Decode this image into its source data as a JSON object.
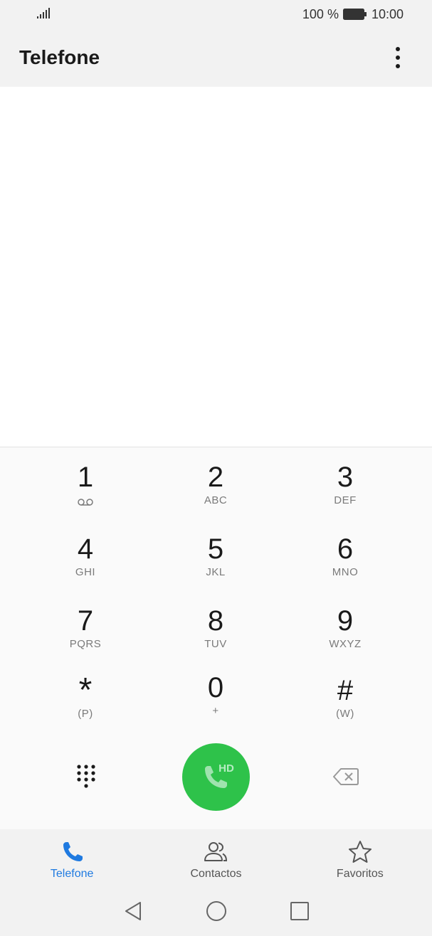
{
  "status_bar": {
    "battery": "100 %",
    "time": "10:00"
  },
  "app_bar": {
    "title": "Telefone"
  },
  "dialpad": {
    "keys": [
      {
        "digit": "1",
        "letters": ""
      },
      {
        "digit": "2",
        "letters": "ABC"
      },
      {
        "digit": "3",
        "letters": "DEF"
      },
      {
        "digit": "4",
        "letters": "GHI"
      },
      {
        "digit": "5",
        "letters": "JKL"
      },
      {
        "digit": "6",
        "letters": "MNO"
      },
      {
        "digit": "7",
        "letters": "PQRS"
      },
      {
        "digit": "8",
        "letters": "TUV"
      },
      {
        "digit": "9",
        "letters": "WXYZ"
      },
      {
        "digit": "*",
        "letters": "(P)"
      },
      {
        "digit": "0",
        "letters": "+"
      },
      {
        "digit": "#",
        "letters": "(W)"
      }
    ],
    "call_badge": "HD"
  },
  "bottom_nav": {
    "items": [
      {
        "label": "Telefone",
        "icon": "phone-icon",
        "active": true
      },
      {
        "label": "Contactos",
        "icon": "contacts-icon",
        "active": false
      },
      {
        "label": "Favoritos",
        "icon": "star-icon",
        "active": false
      }
    ]
  },
  "colors": {
    "accent": "#1f7ae0",
    "call_green": "#2ec24a"
  }
}
